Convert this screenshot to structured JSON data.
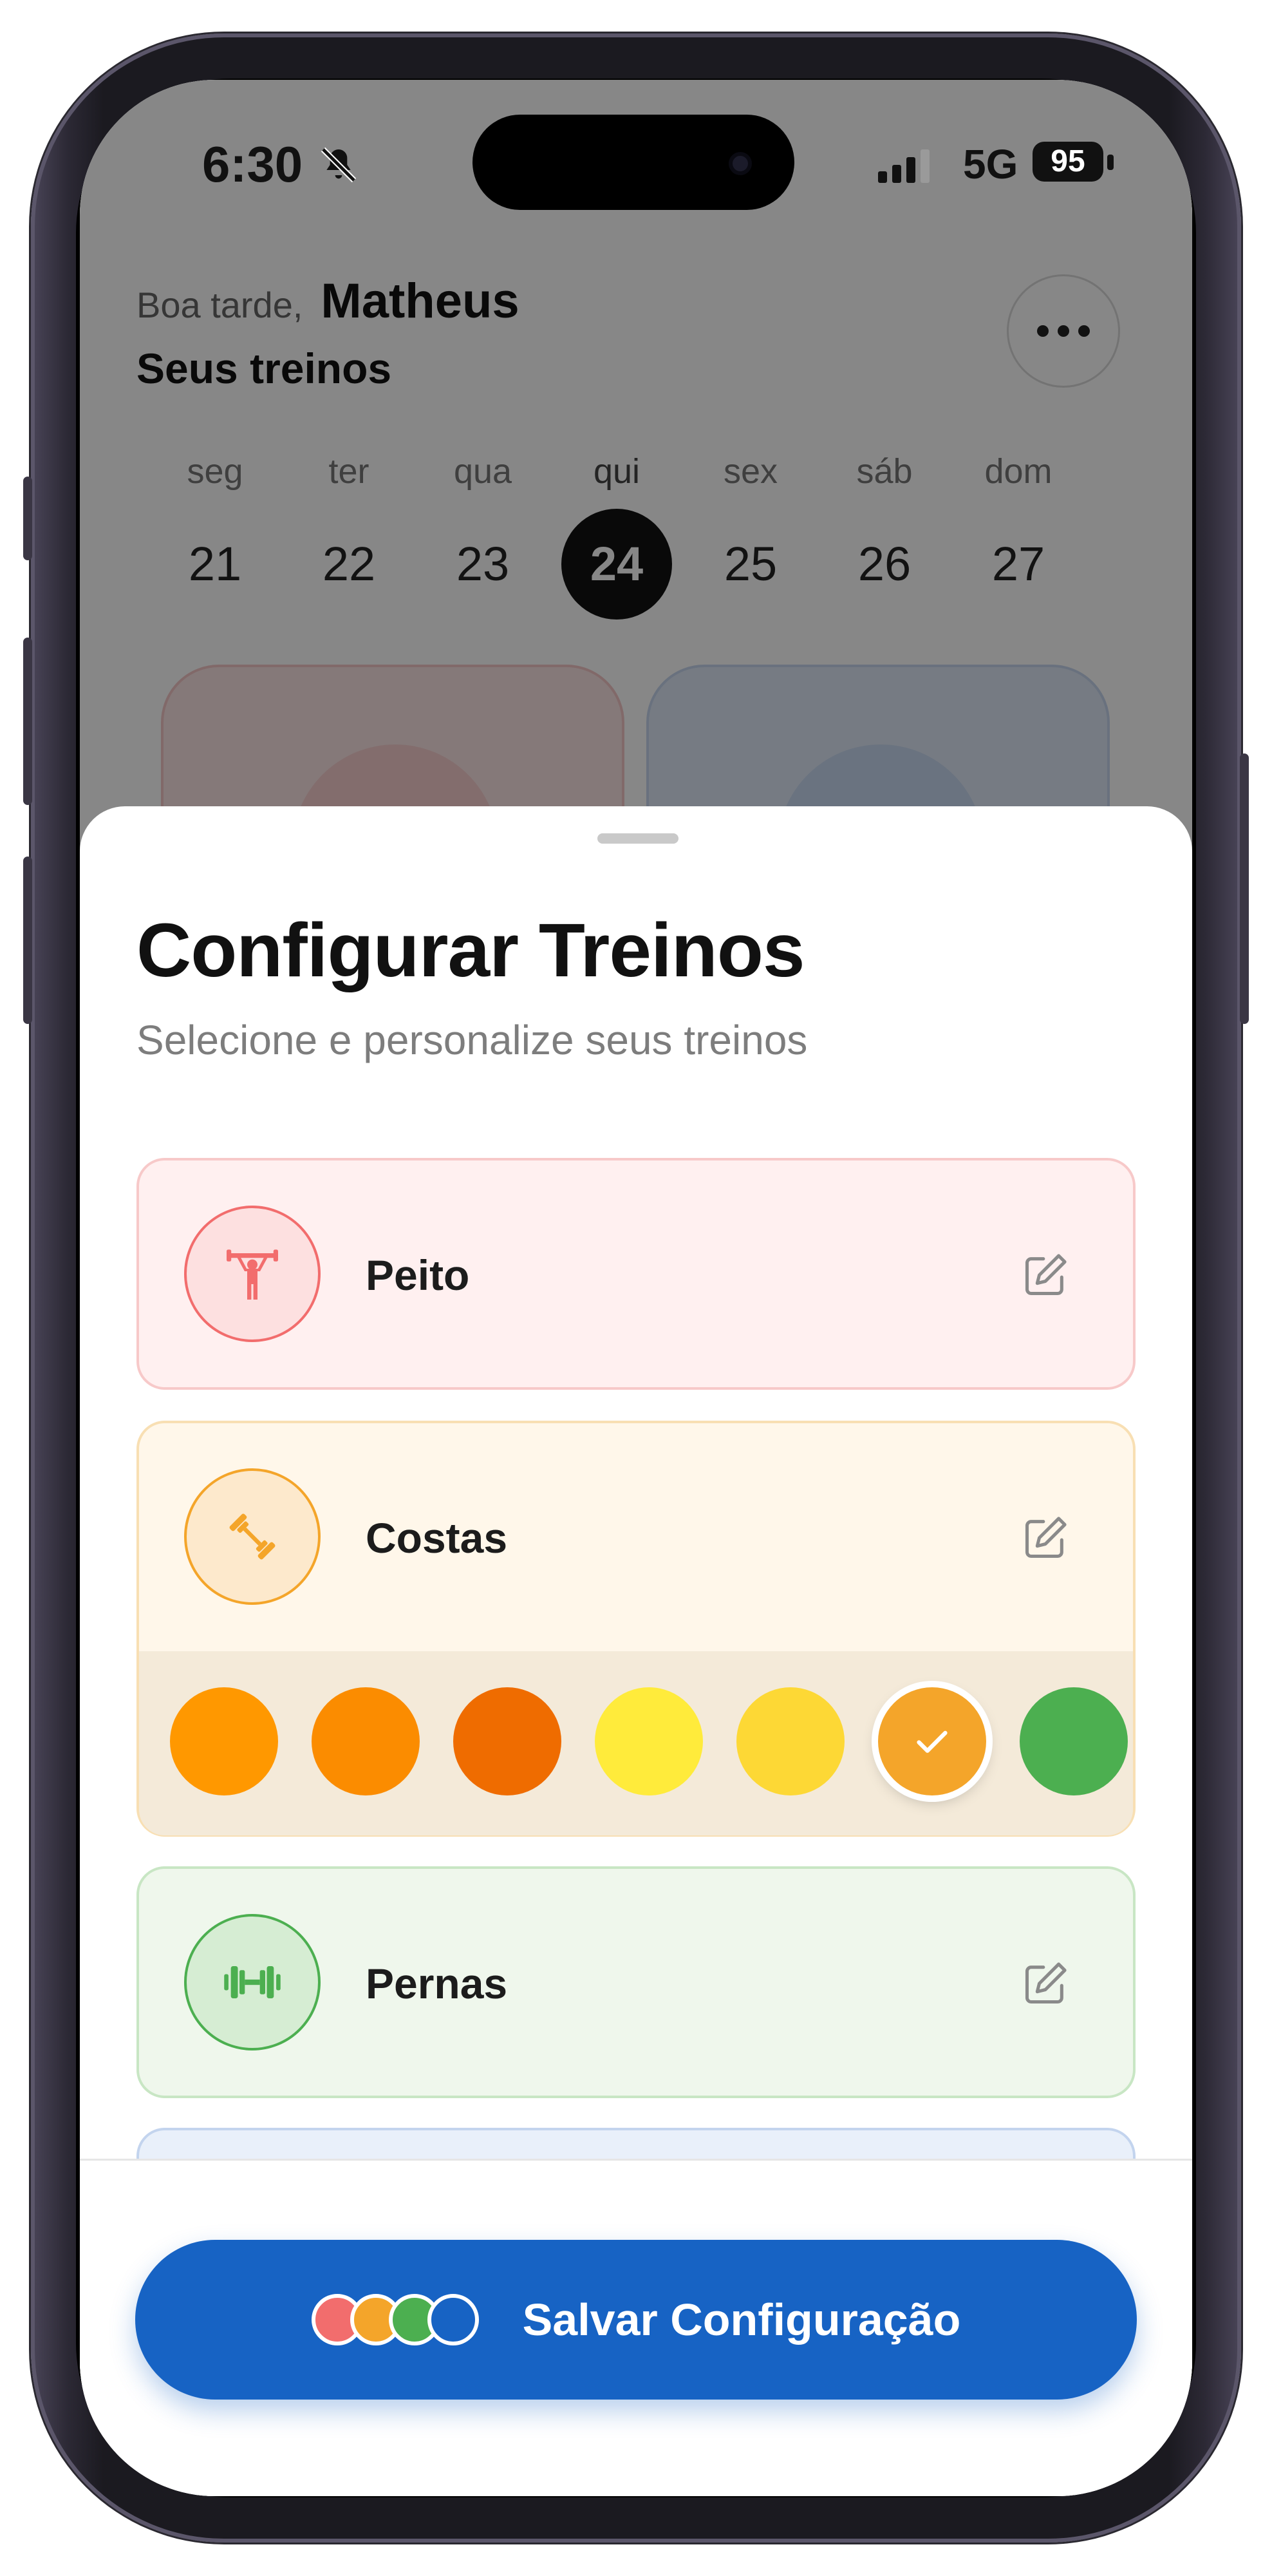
{
  "status_bar": {
    "time": "6:30",
    "network": "5G",
    "battery": "95",
    "icons": [
      "bell-slash-icon",
      "signal-icon",
      "battery-icon"
    ]
  },
  "header": {
    "greeting": "Boa tarde,",
    "user_name": "Matheus",
    "subtitle": "Seus treinos",
    "more_icon": "ellipsis-icon"
  },
  "calendar": {
    "days": [
      {
        "name": "seg",
        "num": "21"
      },
      {
        "name": "ter",
        "num": "22"
      },
      {
        "name": "qua",
        "num": "23"
      },
      {
        "name": "qui",
        "num": "24",
        "active": true
      },
      {
        "name": "sex",
        "num": "25"
      },
      {
        "name": "sáb",
        "num": "26"
      },
      {
        "name": "dom",
        "num": "27"
      }
    ]
  },
  "sheet": {
    "title": "Configurar Treinos",
    "subtitle": "Selecione e personalize seus treinos",
    "workouts": [
      {
        "label": "Peito",
        "icon": "weightlifter-icon",
        "color": "#f26d6d"
      },
      {
        "label": "Costas",
        "icon": "dumbbell-icon",
        "color": "#f4a52a",
        "expanded": true
      },
      {
        "label": "Pernas",
        "icon": "barbell-icon",
        "color": "#4caf50"
      }
    ],
    "color_options": [
      {
        "color": "#ff9800"
      },
      {
        "color": "#fb8c00"
      },
      {
        "color": "#ef6c00"
      },
      {
        "color": "#ffeb3b"
      },
      {
        "color": "#fdd835"
      },
      {
        "color": "#f4a52a",
        "selected": true
      },
      {
        "color": "#4caf50"
      }
    ],
    "save_button": {
      "label": "Salvar Configuração",
      "dot_colors": [
        "#f26d6d",
        "#f4a52a",
        "#4caf50",
        "#1763c4"
      ]
    }
  }
}
